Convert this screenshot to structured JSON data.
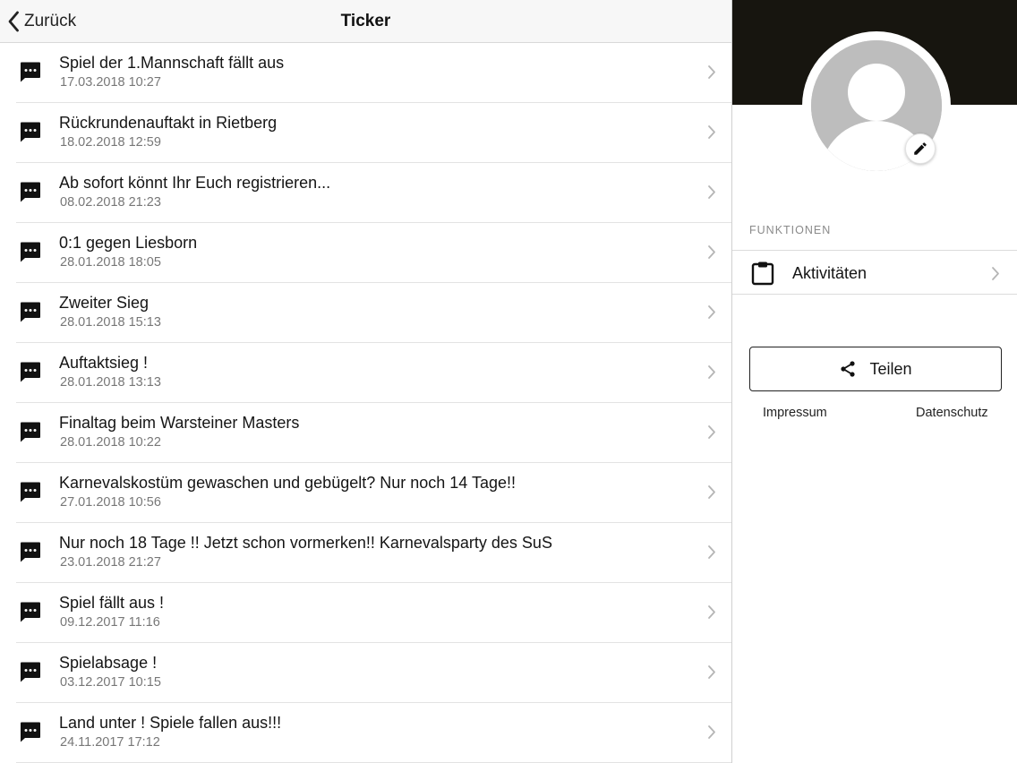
{
  "navbar": {
    "back_label": "Zurück",
    "title": "Ticker"
  },
  "ticker": {
    "items": [
      {
        "title": "Spiel der 1.Mannschaft fällt aus",
        "date": "17.03.2018 10:27"
      },
      {
        "title": "Rückrundenauftakt in Rietberg",
        "date": "18.02.2018 12:59"
      },
      {
        "title": "Ab sofort könnt Ihr Euch registrieren...",
        "date": "08.02.2018 21:23"
      },
      {
        "title": "0:1 gegen Liesborn",
        "date": "28.01.2018 18:05"
      },
      {
        "title": "Zweiter Sieg",
        "date": "28.01.2018 15:13"
      },
      {
        "title": "Auftaktsieg !",
        "date": "28.01.2018 13:13"
      },
      {
        "title": "Finaltag beim Warsteiner Masters",
        "date": "28.01.2018 10:22"
      },
      {
        "title": "Karnevalskostüm gewaschen und gebügelt? Nur noch 14 Tage!!",
        "date": "27.01.2018 10:56"
      },
      {
        "title": "Nur noch 18 Tage !! Jetzt schon vormerken!! Karnevalsparty des SuS",
        "date": "23.01.2018 21:27"
      },
      {
        "title": "Spiel fällt aus !",
        "date": "09.12.2017 11:16"
      },
      {
        "title": "Spielabsage !",
        "date": "03.12.2017 10:15"
      },
      {
        "title": "Land unter ! Spiele fallen aus!!!",
        "date": "24.11.2017 17:12"
      }
    ]
  },
  "profile": {
    "section_label": "FUNKTIONEN",
    "activities_label": "Aktivitäten",
    "share_label": "Teilen",
    "impressum_label": "Impressum",
    "datenschutz_label": "Datenschutz"
  },
  "icons": {
    "back": "chevron-left-icon",
    "item": "chat-bubble-icon",
    "row_action": "chevron-right-icon",
    "edit": "pencil-icon",
    "activities": "clipboard-icon",
    "share": "share-icon"
  },
  "colors": {
    "header_background": "#17150f",
    "avatar_placeholder": "#bdbdbd",
    "text_primary": "#151515",
    "text_secondary": "#777777"
  }
}
